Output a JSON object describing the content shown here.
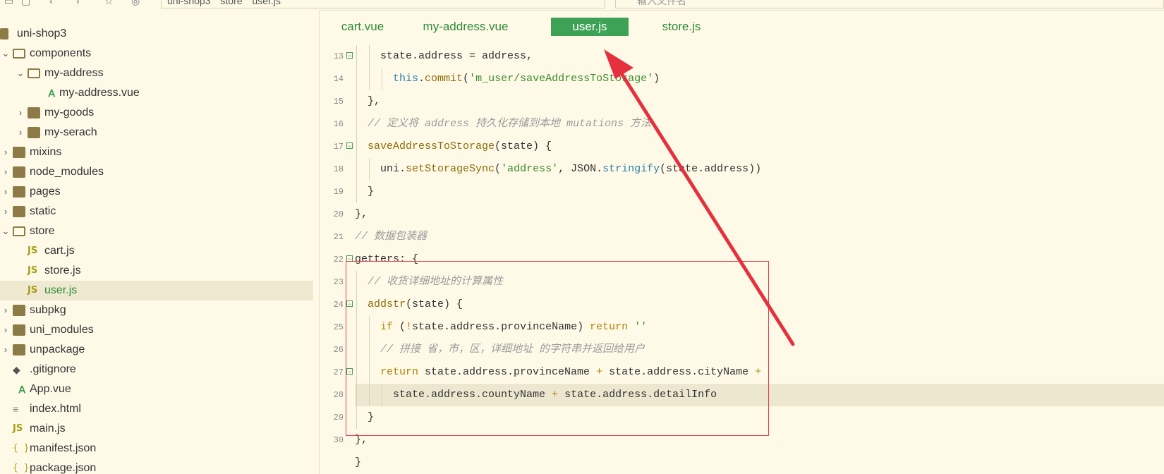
{
  "toolbar": {
    "breadcrumb": [
      "uni-shop3",
      "store",
      "user.js"
    ],
    "search_placeholder": "输入文件名"
  },
  "sidebar": {
    "items": [
      {
        "label": "uni-shop3",
        "type": "project",
        "depth": 0,
        "chevron": ""
      },
      {
        "label": "components",
        "type": "folder-open",
        "depth": 0,
        "chevron": "v"
      },
      {
        "label": "my-address",
        "type": "folder-open",
        "depth": 1,
        "chevron": "v"
      },
      {
        "label": "my-address.vue",
        "type": "vue",
        "depth": 2,
        "chevron": ""
      },
      {
        "label": "my-goods",
        "type": "folder",
        "depth": 1,
        "chevron": ">"
      },
      {
        "label": "my-serach",
        "type": "folder",
        "depth": 1,
        "chevron": ">"
      },
      {
        "label": "mixins",
        "type": "folder",
        "depth": 0,
        "chevron": ">"
      },
      {
        "label": "node_modules",
        "type": "folder",
        "depth": 0,
        "chevron": ">"
      },
      {
        "label": "pages",
        "type": "folder",
        "depth": 0,
        "chevron": ">"
      },
      {
        "label": "static",
        "type": "folder",
        "depth": 0,
        "chevron": ">"
      },
      {
        "label": "store",
        "type": "folder-open",
        "depth": 0,
        "chevron": "v"
      },
      {
        "label": "cart.js",
        "type": "js",
        "depth": 1,
        "chevron": ""
      },
      {
        "label": "store.js",
        "type": "js",
        "depth": 1,
        "chevron": ""
      },
      {
        "label": "user.js",
        "type": "js",
        "depth": 1,
        "chevron": "",
        "selected": true
      },
      {
        "label": "subpkg",
        "type": "folder",
        "depth": 0,
        "chevron": ">"
      },
      {
        "label": "uni_modules",
        "type": "folder",
        "depth": 0,
        "chevron": ">"
      },
      {
        "label": "unpackage",
        "type": "folder",
        "depth": 0,
        "chevron": ">"
      },
      {
        "label": ".gitignore",
        "type": "git",
        "depth": 0,
        "chevron": ""
      },
      {
        "label": "App.vue",
        "type": "vue",
        "depth": 0,
        "chevron": ""
      },
      {
        "label": "index.html",
        "type": "html",
        "depth": 0,
        "chevron": ""
      },
      {
        "label": "main.js",
        "type": "js",
        "depth": 0,
        "chevron": ""
      },
      {
        "label": "manifest.json",
        "type": "json",
        "depth": 0,
        "chevron": ""
      },
      {
        "label": "package.json",
        "type": "json",
        "depth": 0,
        "chevron": ""
      }
    ]
  },
  "tabs": [
    {
      "label": "cart.vue",
      "active": false
    },
    {
      "label": "my-address.vue",
      "active": false
    },
    {
      "label": "user.js",
      "active": true
    },
    {
      "label": "store.js",
      "active": false
    }
  ],
  "editor": {
    "lines": [
      {
        "num": "13",
        "fold": true,
        "indent": 2,
        "html": "state.address = address,"
      },
      {
        "num": "14",
        "fold": false,
        "indent": 3,
        "tokens": [
          [
            "pr",
            "this"
          ],
          [
            "",
            "."
          ],
          [
            "fn",
            "commit"
          ],
          [
            "",
            "("
          ],
          [
            "str",
            "'m_user/saveAddressToStorage'"
          ],
          [
            "",
            ")"
          ]
        ]
      },
      {
        "num": "15",
        "fold": false,
        "indent": 1,
        "tokens": [
          [
            "",
            "},"
          ]
        ]
      },
      {
        "num": "16",
        "fold": false,
        "indent": 1,
        "tokens": [
          [
            "cm",
            "// 定义将 address 持久化存储到本地 mutations 方法"
          ]
        ]
      },
      {
        "num": "17",
        "fold": true,
        "indent": 1,
        "tokens": [
          [
            "fn",
            "saveAddressToStorage"
          ],
          [
            "",
            "(state) {"
          ]
        ]
      },
      {
        "num": "18",
        "fold": false,
        "indent": 2,
        "tokens": [
          [
            "",
            "uni."
          ],
          [
            "fn",
            "setStorageSync"
          ],
          [
            "",
            "("
          ],
          [
            "str",
            "'address'"
          ],
          [
            "",
            ", JSON."
          ],
          [
            "pr",
            "stringify"
          ],
          [
            "",
            "(state.address))"
          ]
        ]
      },
      {
        "num": "19",
        "fold": false,
        "indent": 1,
        "tokens": [
          [
            "",
            "}"
          ]
        ]
      },
      {
        "num": "20",
        "fold": false,
        "indent": 0,
        "tokens": [
          [
            "",
            "},"
          ]
        ]
      },
      {
        "num": "21",
        "fold": false,
        "indent": 0,
        "tokens": [
          [
            "cm",
            "// 数据包装器"
          ]
        ]
      },
      {
        "num": "22",
        "fold": true,
        "indent": 0,
        "tokens": [
          [
            "",
            "getters: {"
          ]
        ]
      },
      {
        "num": "23",
        "fold": false,
        "indent": 1,
        "tokens": [
          [
            "cm",
            "// 收货详细地址的计算属性"
          ]
        ]
      },
      {
        "num": "24",
        "fold": true,
        "indent": 1,
        "tokens": [
          [
            "fn",
            "addstr"
          ],
          [
            "",
            "(state) {"
          ]
        ]
      },
      {
        "num": "25",
        "fold": false,
        "indent": 2,
        "tokens": [
          [
            "kw",
            "if"
          ],
          [
            "",
            " ("
          ],
          [
            "kw",
            "!"
          ],
          [
            "",
            "state.address.provinceName) "
          ],
          [
            "kw",
            "return"
          ],
          [
            "",
            " "
          ],
          [
            "str",
            "''"
          ]
        ]
      },
      {
        "num": "26",
        "fold": false,
        "indent": 2,
        "tokens": [
          [
            "cm",
            "// 拼接 省，市，区，详细地址 的字符串并返回给用户"
          ]
        ]
      },
      {
        "num": "27",
        "fold": true,
        "indent": 2,
        "tokens": [
          [
            "kw",
            "return"
          ],
          [
            "",
            " state.address.provinceName "
          ],
          [
            "kw",
            "+"
          ],
          [
            "",
            " state.address.cityName "
          ],
          [
            "kw",
            "+"
          ]
        ]
      },
      {
        "num": "28",
        "fold": false,
        "indent": 3,
        "hl": true,
        "tokens": [
          [
            "",
            "state.address.countyName "
          ],
          [
            "kw",
            "+"
          ],
          [
            "",
            " state.address.detailInfo"
          ]
        ]
      },
      {
        "num": "29",
        "fold": false,
        "indent": 1,
        "tokens": [
          [
            "",
            "}"
          ]
        ]
      },
      {
        "num": "30",
        "fold": false,
        "indent": 0,
        "tokens": [
          [
            "",
            "},"
          ]
        ]
      },
      {
        "num": "",
        "fold": false,
        "indent": 0,
        "tokens": [
          [
            "",
            "}"
          ]
        ]
      }
    ]
  },
  "colors": {
    "accent_green": "#3ea256",
    "annotation_red": "#e53a4e",
    "background": "#fffae8"
  }
}
